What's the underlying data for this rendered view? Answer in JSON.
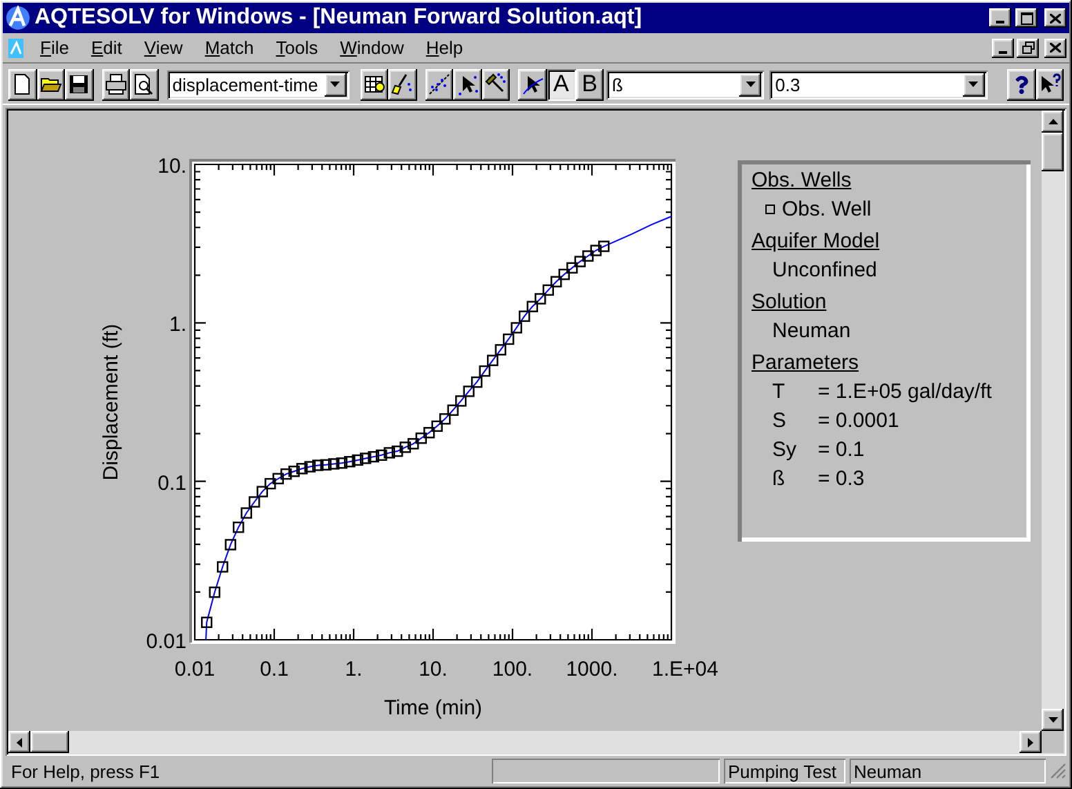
{
  "window": {
    "title": "AQTESOLV for Windows - [Neuman Forward Solution.aqt]"
  },
  "menu": [
    "File",
    "Edit",
    "View",
    "Match",
    "Tools",
    "Window",
    "Help"
  ],
  "toolbar": {
    "view_select": {
      "value": "displacement-time"
    },
    "curve_buttons": [
      {
        "label": "A",
        "selected": true
      },
      {
        "label": "B",
        "selected": false
      }
    ],
    "parameter_select": {
      "value": "ß"
    },
    "parameter_value": {
      "value": "0.3"
    }
  },
  "chart": {
    "ytick_labels": [
      "10.",
      "1.",
      "0.1",
      "0.01"
    ],
    "ylabel": "Displacement (ft)",
    "xtick_labels": [
      "0.01",
      "0.1",
      "1.",
      "10.",
      "100.",
      "1000.",
      "1.E+04"
    ],
    "xlabel": "Time (min)"
  },
  "legend": {
    "sections": [
      {
        "heading": "Obs. Wells",
        "items": [
          {
            "kind": "marker",
            "text": "Obs. Well"
          }
        ]
      },
      {
        "heading": "Aquifer Model",
        "items": [
          {
            "kind": "text",
            "text": "Unconfined"
          }
        ]
      },
      {
        "heading": "Solution",
        "items": [
          {
            "kind": "text",
            "text": "Neuman"
          }
        ]
      },
      {
        "heading": "Parameters",
        "items": [
          {
            "kind": "param",
            "name": "T",
            "value": "= 1.E+05 gal/day/ft"
          },
          {
            "kind": "param",
            "name": "S",
            "value": "= 0.0001"
          },
          {
            "kind": "param",
            "name": "Sy",
            "value": "= 0.1"
          },
          {
            "kind": "param",
            "name": "ß",
            "value": "= 0.3"
          }
        ]
      }
    ]
  },
  "status_bar": {
    "message": "For Help, press F1",
    "panes": [
      "Pumping Test",
      "Neuman"
    ]
  }
}
